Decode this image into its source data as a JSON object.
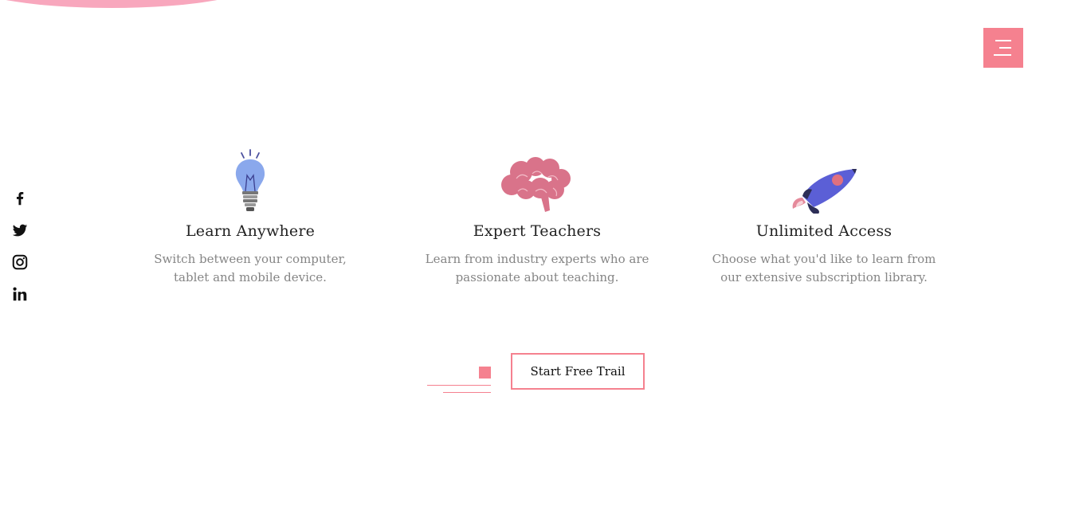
{
  "menu": {
    "icon": "hamburger-menu-icon"
  },
  "social": [
    {
      "name": "facebook",
      "icon": "facebook-icon"
    },
    {
      "name": "twitter",
      "icon": "twitter-icon"
    },
    {
      "name": "instagram",
      "icon": "instagram-icon"
    },
    {
      "name": "linkedin",
      "icon": "linkedin-icon"
    }
  ],
  "features": [
    {
      "icon": "lightbulb-icon",
      "title": "Learn Anywhere",
      "text": "Switch between your computer, tablet and mobile device."
    },
    {
      "icon": "brain-icon",
      "title": "Expert Teachers",
      "text": "Learn from industry experts who are passionate about teaching."
    },
    {
      "icon": "rocket-icon",
      "title": "Unlimited Access",
      "text": "Choose what you'd like to learn from our extensive subscription library."
    }
  ],
  "cta": {
    "label": "Start Free Trail"
  },
  "colors": {
    "accent": "#f5818f",
    "blob": "#f8a7bd",
    "bulb": "#8aa8ec",
    "brain": "#d9738a",
    "rocket": "#5b5fd6"
  }
}
